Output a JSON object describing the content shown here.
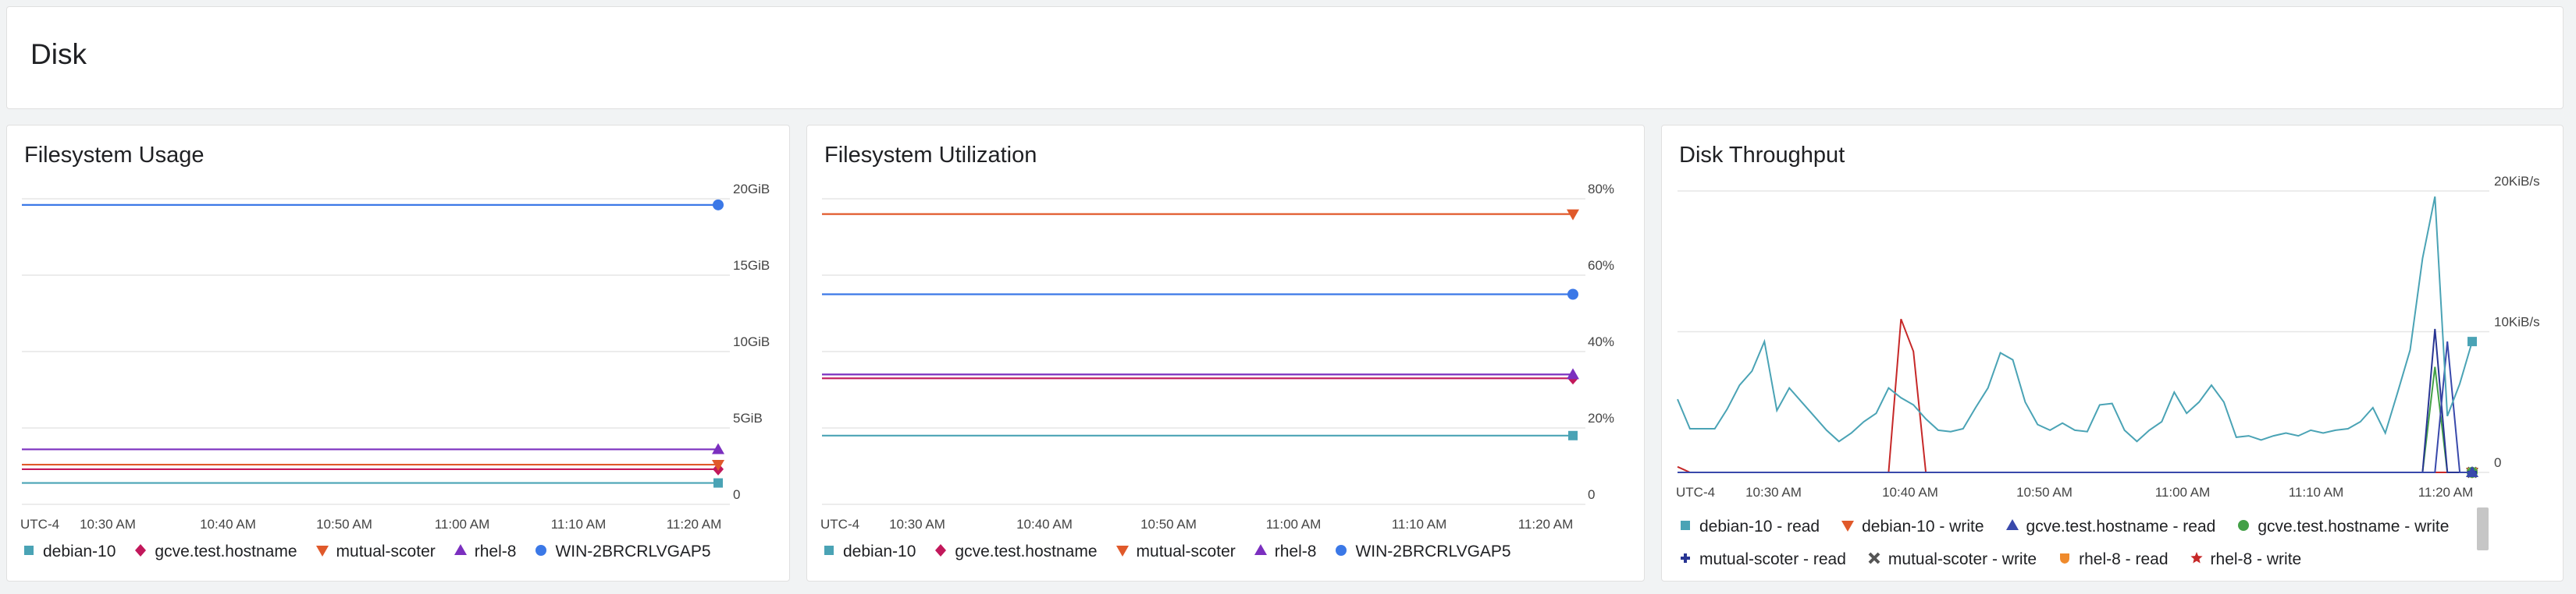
{
  "page": {
    "title": "Disk"
  },
  "time_axis": {
    "timezone": "UTC-4",
    "ticks": [
      "10:30 AM",
      "10:40 AM",
      "10:50 AM",
      "11:00 AM",
      "11:10 AM",
      "11:20 AM"
    ]
  },
  "colors": {
    "debian-10": "#4aa3b5",
    "gcve.test.hostname": "#c2185b",
    "mutual-scoter": "#e0592a",
    "rhel-8": "#7b2fbf",
    "WIN-2BRCRLVGAP5": "#3b78e7"
  },
  "filesystem_usage": {
    "title": "Filesystem Usage",
    "legend": [
      "debian-10",
      "gcve.test.hostname",
      "mutual-scoter",
      "rhel-8",
      "WIN-2BRCRLVGAP5"
    ]
  },
  "filesystem_utilization": {
    "title": "Filesystem Utilization",
    "legend": [
      "debian-10",
      "gcve.test.hostname",
      "mutual-scoter",
      "rhel-8",
      "WIN-2BRCRLVGAP5"
    ]
  },
  "disk_throughput": {
    "title": "Disk Throughput",
    "legend": [
      "debian-10 - read",
      "debian-10 - write",
      "gcve.test.hostname - read",
      "gcve.test.hostname - write",
      "mutual-scoter - read",
      "mutual-scoter - write",
      "rhel-8 - read",
      "rhel-8 - write"
    ]
  },
  "chart_data": [
    {
      "type": "line",
      "title": "Filesystem Usage",
      "x_range": [
        "10:24",
        "11:22"
      ],
      "y_ticks": [
        "0",
        "5GiB",
        "10GiB",
        "15GiB",
        "20GiB"
      ],
      "ylim": [
        0,
        20
      ],
      "y_unit": "GiB",
      "grid": true,
      "series": [
        {
          "name": "debian-10",
          "marker": "square",
          "y": 1.4
        },
        {
          "name": "gcve.test.hostname",
          "marker": "diamond",
          "y": 2.3
        },
        {
          "name": "mutual-scoter",
          "marker": "triangle-down",
          "y": 2.6
        },
        {
          "name": "rhel-8",
          "marker": "triangle-up",
          "y": 3.6
        },
        {
          "name": "WIN-2BRCRLVGAP5",
          "marker": "circle",
          "y": 19.6
        }
      ]
    },
    {
      "type": "line",
      "title": "Filesystem Utilization",
      "x_range": [
        "10:24",
        "11:22"
      ],
      "y_ticks": [
        "0",
        "20%",
        "40%",
        "60%",
        "80%"
      ],
      "ylim": [
        0,
        80
      ],
      "y_unit": "%",
      "grid": true,
      "series": [
        {
          "name": "debian-10",
          "marker": "square",
          "y": 18
        },
        {
          "name": "gcve.test.hostname",
          "marker": "diamond",
          "y": 33
        },
        {
          "name": "mutual-scoter",
          "marker": "triangle-down",
          "y": 76
        },
        {
          "name": "rhel-8",
          "marker": "triangle-up",
          "y": 34
        },
        {
          "name": "WIN-2BRCRLVGAP5",
          "marker": "circle",
          "y": 55
        }
      ]
    },
    {
      "type": "line",
      "title": "Disk Throughput",
      "x_range": [
        "10:24",
        "11:22"
      ],
      "y_ticks": [
        "0",
        "10KiB/s",
        "20KiB/s"
      ],
      "ylim": [
        0,
        20
      ],
      "y_unit": "KiB/s",
      "grid": true,
      "series": [
        {
          "name": "debian-10 - read",
          "color": "#4aa3b5",
          "marker": "square",
          "y": [
            5.2,
            3.1,
            3.1,
            3.1,
            4.5,
            6.2,
            7.2,
            9.3,
            4.4,
            6.0,
            5.0,
            4.0,
            3.0,
            2.2,
            2.8,
            3.6,
            4.2,
            6.0,
            5.3,
            4.8,
            3.8,
            3.0,
            2.9,
            3.1,
            4.6,
            6.0,
            8.5,
            8.0,
            5.0,
            3.4,
            3.0,
            3.5,
            3.0,
            2.9,
            4.8,
            4.9,
            3.0,
            2.2,
            3.0,
            3.6,
            5.7,
            4.2,
            5.0,
            6.2,
            5.0,
            2.5,
            2.6,
            2.3,
            2.6,
            2.8,
            2.6,
            3.0,
            2.8,
            3.0,
            3.1,
            3.6,
            4.6,
            2.8,
            5.7,
            8.7,
            15.2,
            19.6,
            4.0,
            6.3,
            9.3
          ]
        },
        {
          "name": "rhel-8 - write",
          "color": "#c62828",
          "marker": "star",
          "y": [
            0.4,
            0,
            0,
            0,
            0,
            0,
            0,
            0,
            0,
            0,
            0,
            0,
            0,
            0,
            0,
            0,
            0,
            0,
            10.9,
            8.6,
            0,
            0,
            0,
            0,
            0,
            0,
            0,
            0,
            0,
            0,
            0,
            0,
            0,
            0,
            0,
            0,
            0,
            0,
            0,
            0,
            0,
            0,
            0,
            0,
            0,
            0,
            0,
            0,
            0,
            0,
            0,
            0,
            0,
            0,
            0,
            0,
            0,
            0,
            0,
            0,
            0,
            0,
            0,
            0,
            0
          ]
        },
        {
          "name": "gcve.test.hostname - write",
          "color": "#43a047",
          "marker": "circle",
          "y": [
            0,
            0,
            0,
            0,
            0,
            0,
            0,
            0,
            0,
            0,
            0,
            0,
            0,
            0,
            0,
            0,
            0,
            0,
            0,
            0,
            0,
            0,
            0,
            0,
            0,
            0,
            0,
            0,
            0,
            0,
            0,
            0,
            0,
            0,
            0,
            0,
            0,
            0,
            0,
            0,
            0,
            0,
            0,
            0,
            0,
            0,
            0,
            0,
            0,
            0,
            0,
            0,
            0,
            0,
            0,
            0,
            0,
            0,
            0,
            0,
            0,
            7.5,
            0,
            0,
            0
          ]
        },
        {
          "name": "mutual-scoter - read",
          "color": "#283593",
          "marker": "cross",
          "y": [
            0,
            0,
            0,
            0,
            0,
            0,
            0,
            0,
            0,
            0,
            0,
            0,
            0,
            0,
            0,
            0,
            0,
            0,
            0,
            0,
            0,
            0,
            0,
            0,
            0,
            0,
            0,
            0,
            0,
            0,
            0,
            0,
            0,
            0,
            0,
            0,
            0,
            0,
            0,
            0,
            0,
            0,
            0,
            0,
            0,
            0,
            0,
            0,
            0,
            0,
            0,
            0,
            0,
            0,
            0,
            0,
            0,
            0,
            0,
            0,
            0,
            10.2,
            0,
            0,
            0
          ]
        },
        {
          "name": "gcve.test.hostname - read",
          "color": "#3949ab",
          "marker": "triangle-up",
          "y": [
            0,
            0,
            0,
            0,
            0,
            0,
            0,
            0,
            0,
            0,
            0,
            0,
            0,
            0,
            0,
            0,
            0,
            0,
            0,
            0,
            0,
            0,
            0,
            0,
            0,
            0,
            0,
            0,
            0,
            0,
            0,
            0,
            0,
            0,
            0,
            0,
            0,
            0,
            0,
            0,
            0,
            0,
            0,
            0,
            0,
            0,
            0,
            0,
            0,
            0,
            0,
            0,
            0,
            0,
            0,
            0,
            0,
            0,
            0,
            0,
            0,
            0,
            9.3,
            0,
            0
          ]
        },
        {
          "name": "debian-10 - write",
          "color": "#e0592a",
          "marker": "triangle-down",
          "y": [
            0,
            0,
            0,
            0,
            0,
            0,
            0,
            0,
            0,
            0,
            0,
            0,
            0,
            0,
            0,
            0,
            0,
            0,
            0,
            0,
            0,
            0,
            0,
            0,
            0,
            0,
            0,
            0,
            0,
            0,
            0,
            0,
            0,
            0,
            0,
            0,
            0,
            0,
            0,
            0,
            0,
            0,
            0,
            0,
            0,
            0,
            0,
            0,
            0,
            0,
            0,
            0,
            0,
            0,
            0,
            0,
            0,
            0,
            0,
            0,
            0,
            0,
            0,
            0,
            0
          ]
        },
        {
          "name": "mutual-scoter - write",
          "color": "#555555",
          "marker": "x",
          "y": [
            0,
            0,
            0,
            0,
            0,
            0,
            0,
            0,
            0,
            0,
            0,
            0,
            0,
            0,
            0,
            0,
            0,
            0,
            0,
            0,
            0,
            0,
            0,
            0,
            0,
            0,
            0,
            0,
            0,
            0,
            0,
            0,
            0,
            0,
            0,
            0,
            0,
            0,
            0,
            0,
            0,
            0,
            0,
            0,
            0,
            0,
            0,
            0,
            0,
            0,
            0,
            0,
            0,
            0,
            0,
            0,
            0,
            0,
            0,
            0,
            0,
            0,
            0,
            0,
            0
          ]
        },
        {
          "name": "rhel-8 - read",
          "color": "#ef8a2c",
          "marker": "shield",
          "y": [
            0,
            0,
            0,
            0,
            0,
            0,
            0,
            0,
            0,
            0,
            0,
            0,
            0,
            0,
            0,
            0,
            0,
            0,
            0,
            0,
            0,
            0,
            0,
            0,
            0,
            0,
            0,
            0,
            0,
            0,
            0,
            0,
            0,
            0,
            0,
            0,
            0,
            0,
            0,
            0,
            0,
            0,
            0,
            0,
            0,
            0,
            0,
            0,
            0,
            0,
            0,
            0,
            0,
            0,
            0,
            0,
            0,
            0,
            0,
            0,
            0,
            0,
            0,
            0,
            0
          ]
        }
      ]
    }
  ]
}
